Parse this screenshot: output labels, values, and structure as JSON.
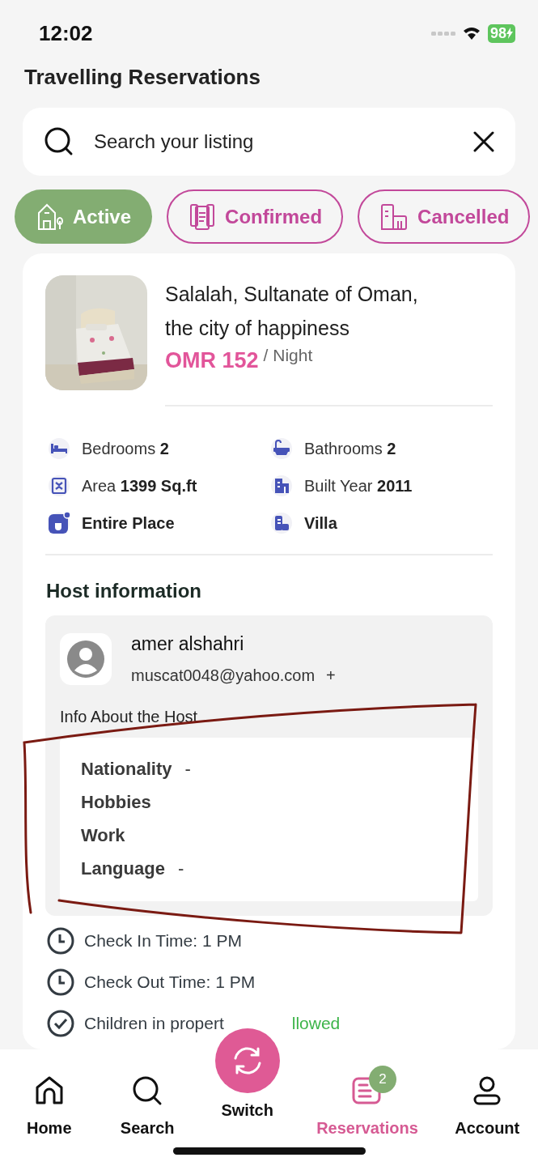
{
  "status_bar": {
    "time": "12:02",
    "battery": "98"
  },
  "title": "Travelling Reservations",
  "search": {
    "placeholder": "Search your listing"
  },
  "filters": [
    {
      "label": "Active",
      "selected": true
    },
    {
      "label": "Confirmed",
      "selected": false
    },
    {
      "label": "Cancelled",
      "selected": false
    }
  ],
  "listing": {
    "title": "Salalah, Sultanate of Oman, the city of happiness",
    "price": "OMR 152",
    "unit": "/ Night",
    "features": [
      {
        "label": "Bedrooms",
        "value": "2"
      },
      {
        "label": "Bathrooms",
        "value": "2"
      },
      {
        "label": "Area",
        "value": "1399 Sq.ft"
      },
      {
        "label": "Built Year",
        "value": "2011"
      },
      {
        "value": "Entire Place"
      },
      {
        "value": "Villa"
      }
    ]
  },
  "host": {
    "heading": "Host information",
    "name": "amer alshahri",
    "email": "muscat0048@yahoo.com",
    "email_suffix": "+",
    "info_heading": "Info About the Host",
    "info": [
      {
        "label": "Nationality",
        "value": "-"
      },
      {
        "label": "Hobbies"
      },
      {
        "label": "Work"
      },
      {
        "label": "Language",
        "value": "-"
      }
    ]
  },
  "rules": [
    {
      "kind": "time",
      "text": "Check In Time: 1 PM"
    },
    {
      "kind": "time",
      "text": "Check Out Time: 1 PM"
    },
    {
      "kind": "check",
      "text": "Children in propert",
      "status": "llowed"
    }
  ],
  "nav": [
    {
      "kind": "tab",
      "label": "Home",
      "selected": false
    },
    {
      "kind": "tab",
      "label": "Search",
      "selected": false
    },
    {
      "kind": "fab",
      "label": "Switch",
      "selected": false
    },
    {
      "kind": "tab",
      "label": "Reservations",
      "selected": true,
      "badge": "2"
    },
    {
      "kind": "tab",
      "label": "Account",
      "selected": false
    }
  ]
}
